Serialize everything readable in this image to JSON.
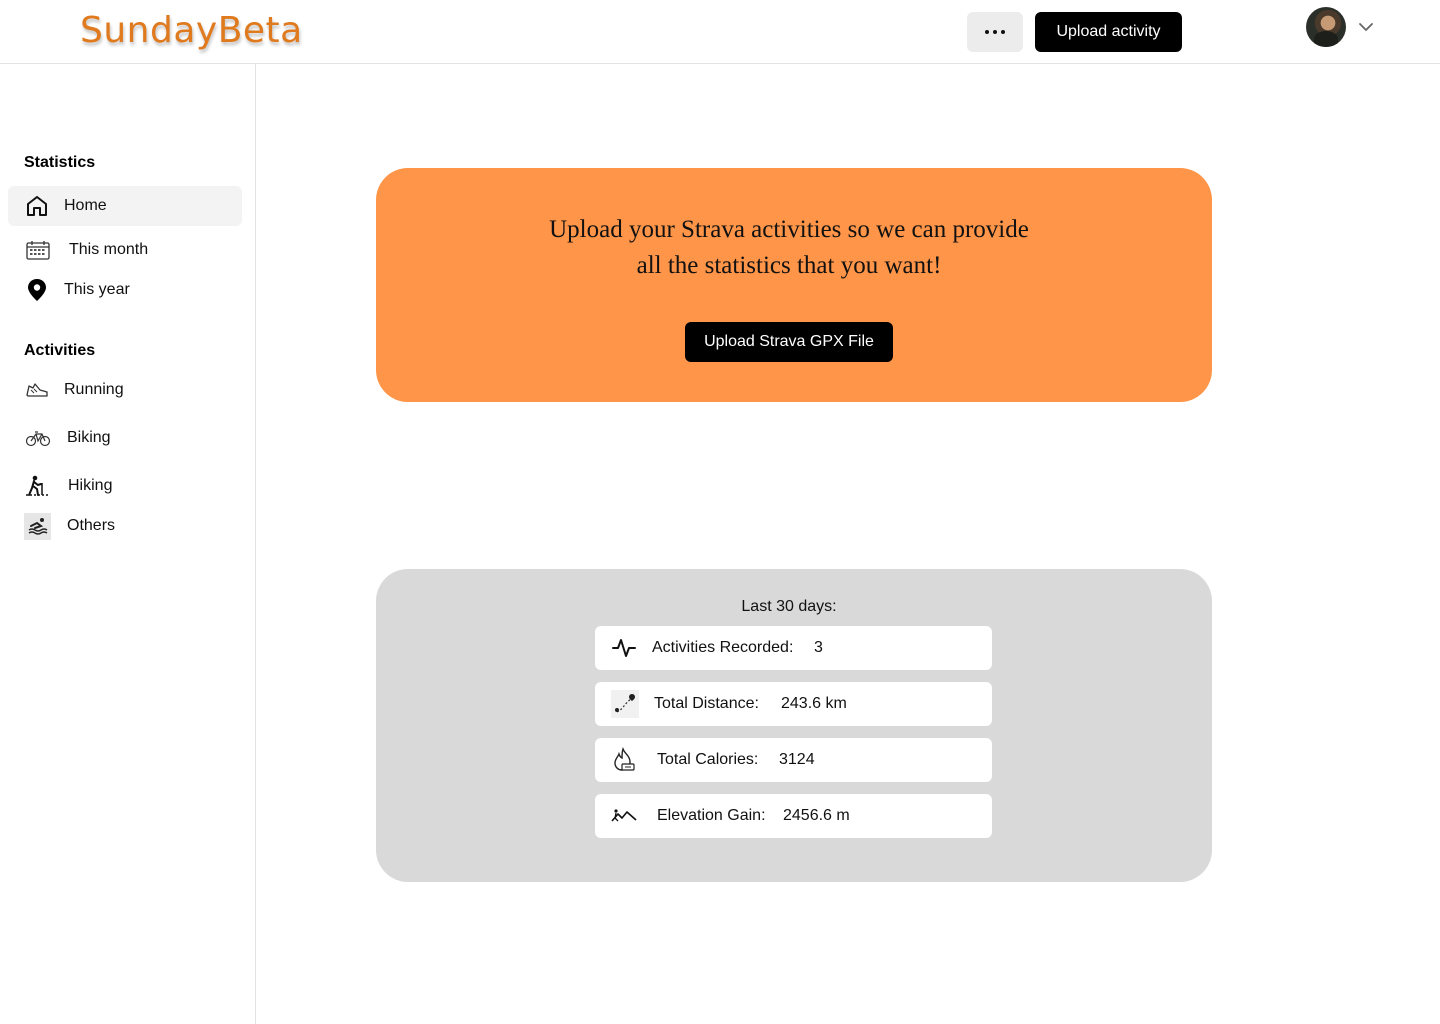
{
  "brand": {
    "name": "SundayBeta"
  },
  "header": {
    "more_icon": "more-horizontal-icon",
    "upload_label": "Upload activity",
    "chevron_icon": "chevron-down-icon"
  },
  "sidebar": {
    "statistics_title": "Statistics",
    "statistics_items": [
      {
        "label": "Home",
        "icon": "home-icon",
        "active": true
      },
      {
        "label": "This month",
        "icon": "calendar-icon",
        "active": false
      },
      {
        "label": "This year",
        "icon": "map-pin-icon",
        "active": false
      }
    ],
    "activities_title": "Activities",
    "activities_items": [
      {
        "label": "Running",
        "icon": "running-shoe-icon"
      },
      {
        "label": "Biking",
        "icon": "bicycle-icon"
      },
      {
        "label": "Hiking",
        "icon": "hiking-icon"
      },
      {
        "label": "Others",
        "icon": "swimming-icon"
      }
    ]
  },
  "promo": {
    "line1": "Upload your Strava activities so we can provide",
    "line2": "all the statistics that you want!",
    "button_label": "Upload Strava GPX File",
    "background": "#ff9548"
  },
  "stats": {
    "title": "Last 30 days:",
    "rows": [
      {
        "label": "Activities Recorded:",
        "value": "3",
        "icon": "activity-pulse-icon"
      },
      {
        "label": "Total Distance:",
        "value": "243.6 km",
        "icon": "route-distance-icon"
      },
      {
        "label": "Total Calories:",
        "value": "3124",
        "icon": "calories-flame-icon"
      },
      {
        "label": "Elevation Gain:",
        "value": "2456.6 m",
        "icon": "elevation-icon"
      }
    ]
  },
  "colors": {
    "brand": "#e07a1f",
    "accent": "#ff9548",
    "card_gray": "#d9d9d9"
  }
}
